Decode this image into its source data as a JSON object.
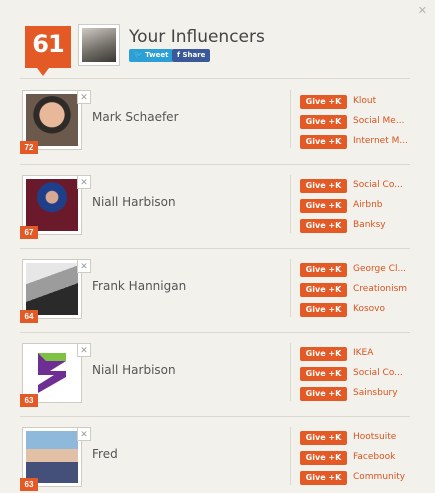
{
  "header": {
    "score": "61",
    "title": "Your Influencers",
    "tweet_label": "Tweet",
    "share_label": "Share"
  },
  "give_label": "Give +K",
  "influencers": [
    {
      "name": "Mark Schaefer",
      "score": "72",
      "topics": [
        "Klout",
        "Social Me...",
        "Internet M..."
      ]
    },
    {
      "name": "Niall Harbison",
      "score": "67",
      "topics": [
        "Social Co...",
        "Airbnb",
        "Banksy"
      ]
    },
    {
      "name": "Frank Hannigan",
      "score": "64",
      "topics": [
        "George Cl...",
        "Creationism",
        "Kosovo"
      ]
    },
    {
      "name": "Niall Harbison",
      "score": "63",
      "topics": [
        "IKEA",
        "Social Co...",
        "Sainsbury"
      ]
    },
    {
      "name": "Fred",
      "score": "63",
      "topics": [
        "Hootsuite",
        "Facebook",
        "Community"
      ]
    }
  ],
  "colors": {
    "accent": "#e45a26",
    "twitter": "#2a9fd8",
    "facebook": "#3b5998",
    "background": "#f3f1ec"
  }
}
